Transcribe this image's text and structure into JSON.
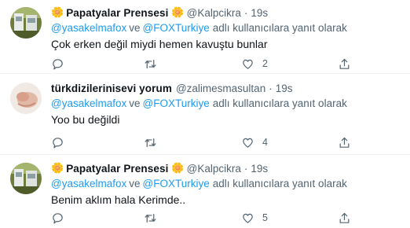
{
  "tweets": [
    {
      "name": "Papatyalar Prensesi",
      "handle": "@Kalpcikra",
      "time": "19s",
      "reply_users": [
        "@yasakelmafox",
        "@FOXTurkiye"
      ],
      "reply_joiner": "ve",
      "reply_suffix": "adlı kullanıcılara yanıt olarak",
      "text": "Çok erken değil miydi hemen kavuştu bunlar",
      "likes": "2",
      "has_flower": true,
      "avatar": "flower-photo"
    },
    {
      "name": "türkdizilerinisevi yorum",
      "handle": "@zalimesmasultan",
      "time": "19s",
      "reply_users": [
        "@yasakelmafox",
        "@FOXTurkiye"
      ],
      "reply_joiner": "ve",
      "reply_suffix": "adlı kullanıcılara yanıt olarak",
      "text": "Yoo bu değildi",
      "likes": "4",
      "has_flower": false,
      "avatar": "hand-photo"
    },
    {
      "name": "Papatyalar Prensesi",
      "handle": "@Kalpcikra",
      "time": "19s",
      "reply_users": [
        "@yasakelmafox",
        "@FOXTurkiye"
      ],
      "reply_joiner": "ve",
      "reply_suffix": "adlı kullanıcılara yanıt olarak",
      "text": "Benim aklım hala Kerimde..",
      "likes": "5",
      "has_flower": true,
      "avatar": "flower-photo"
    }
  ],
  "icons": {
    "reply": "comment-icon",
    "retweet": "retweet-icon",
    "like": "heart-icon",
    "share": "share-icon",
    "flower": "daisy-emoji"
  },
  "colors": {
    "link": "#1d9bf0",
    "muted": "#536471",
    "text": "#0f1419"
  }
}
